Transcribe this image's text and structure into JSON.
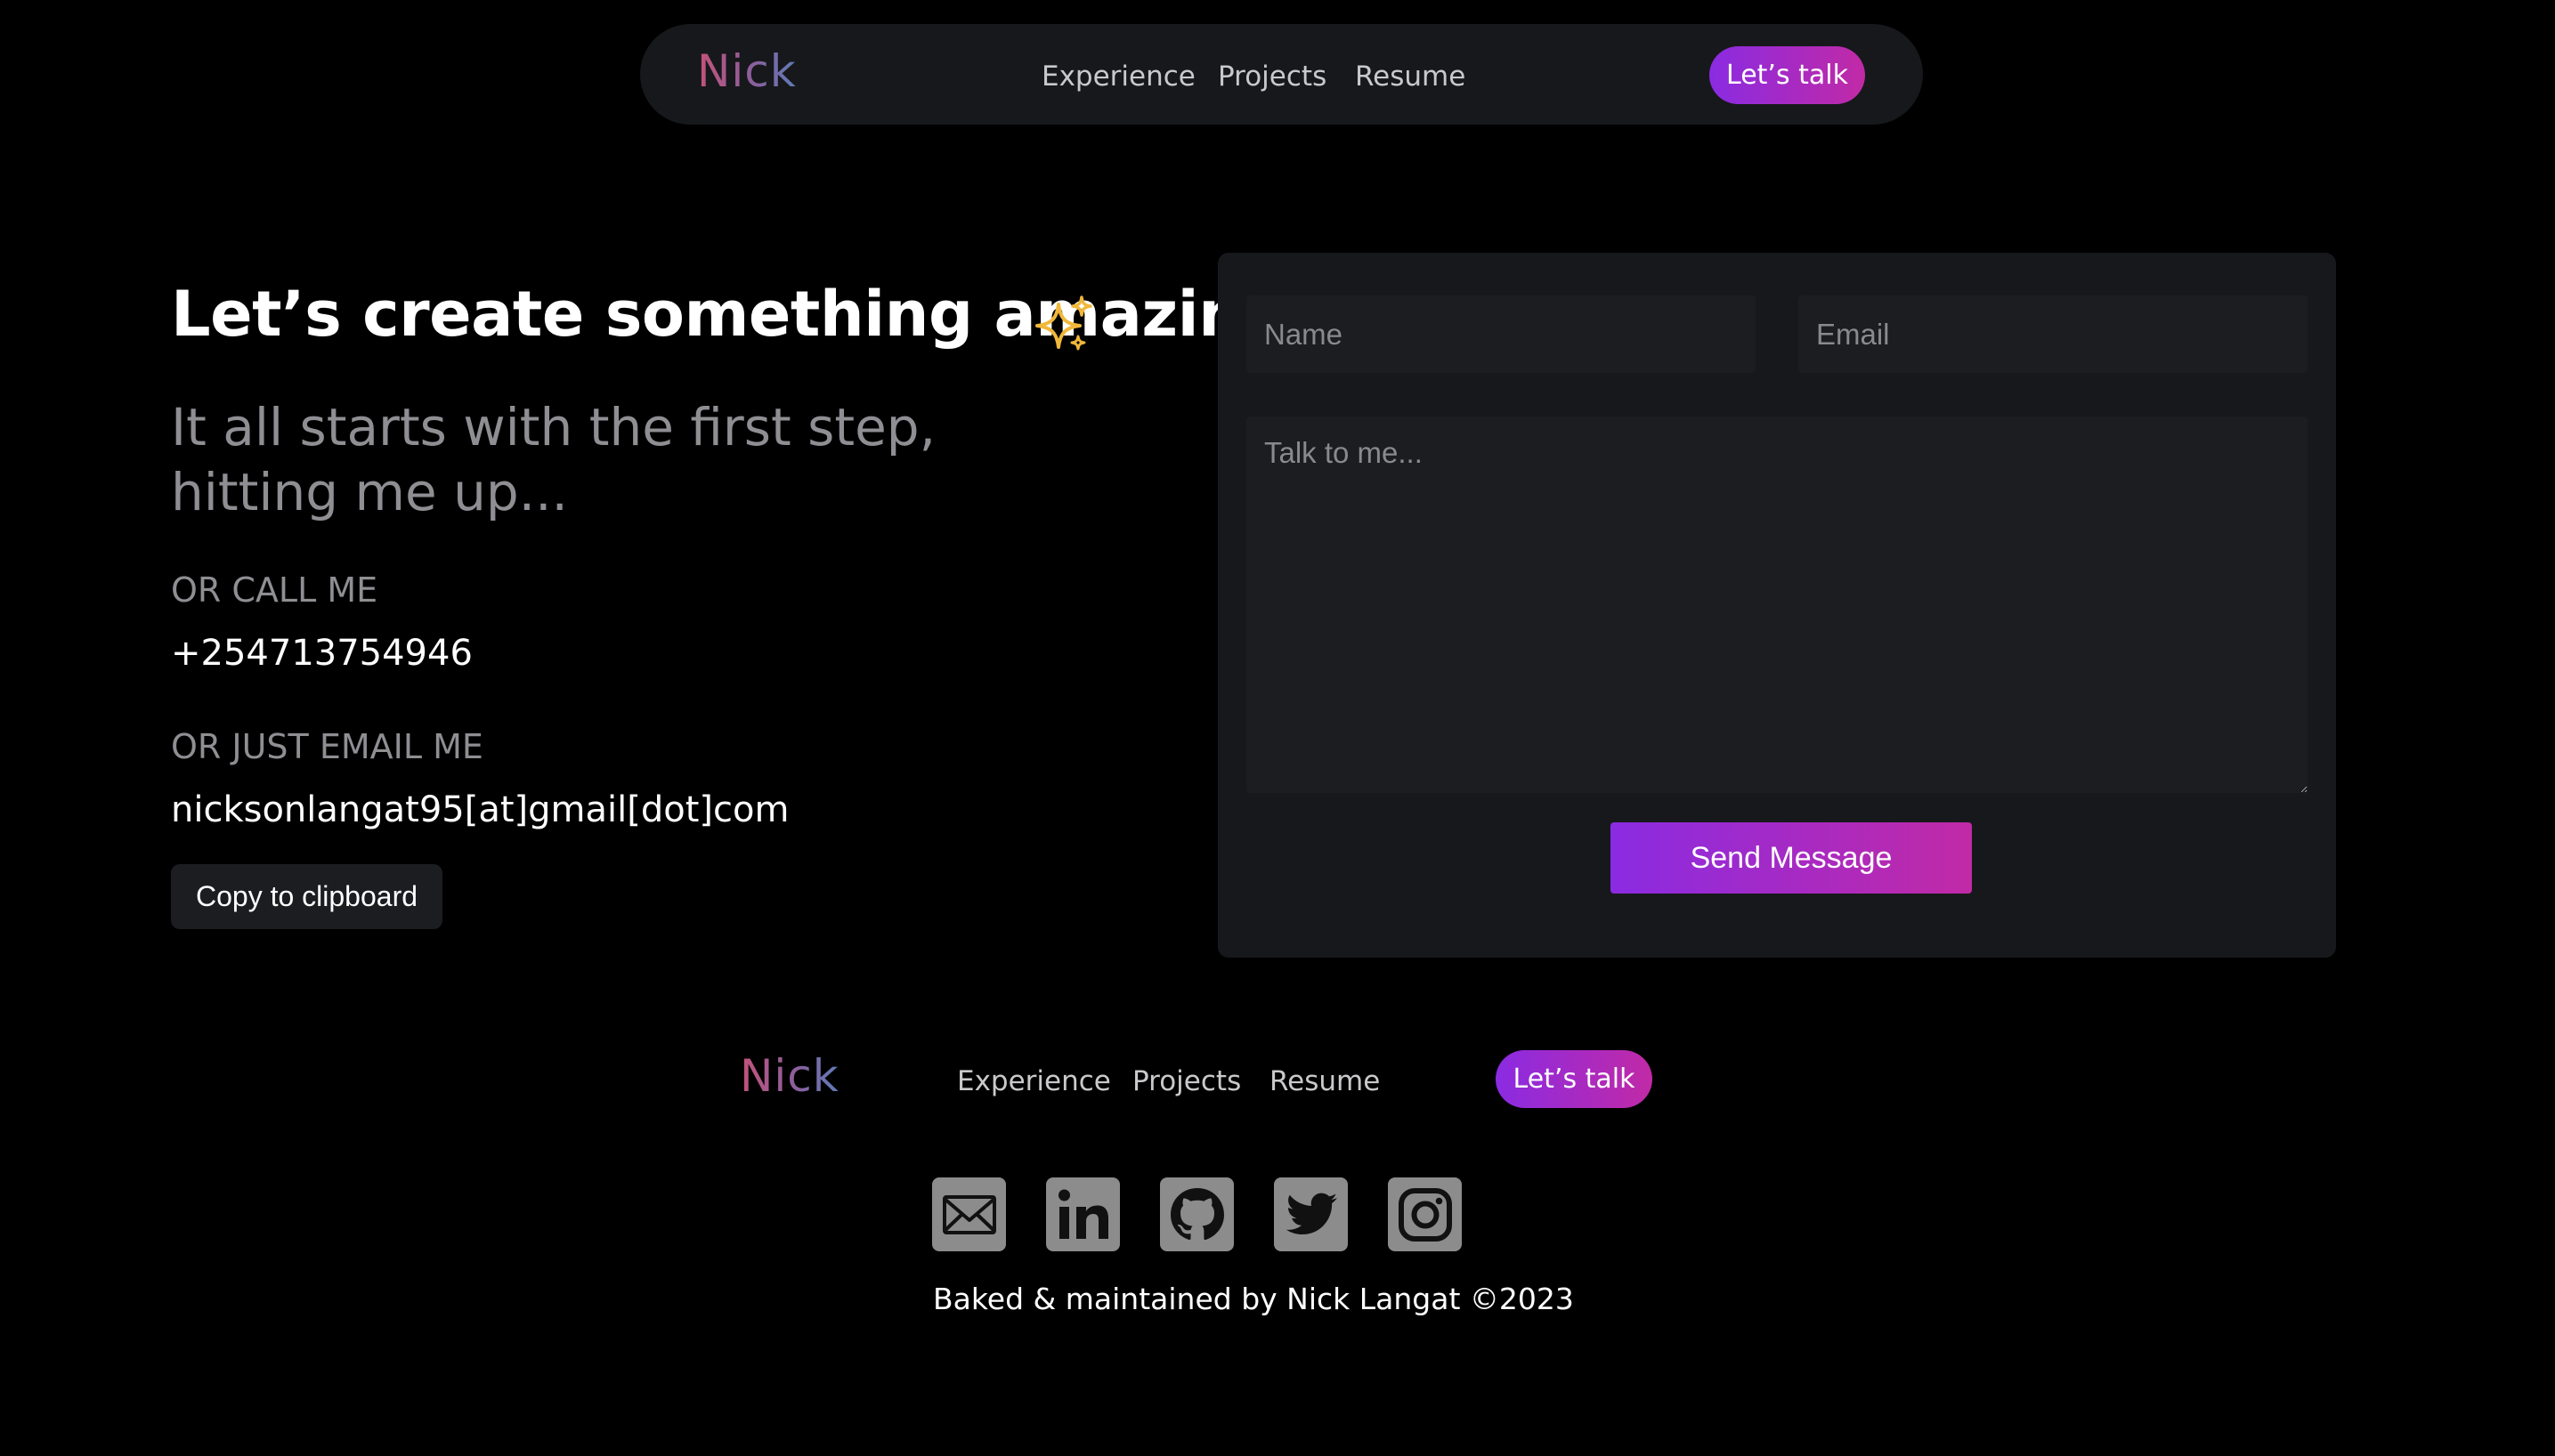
{
  "nav": {
    "logo": "Nick",
    "links": [
      "Experience",
      "Projects",
      "Resume"
    ],
    "cta": "Let’s talk"
  },
  "hero": {
    "headline": "Let’s create something amazing",
    "subline_1": "It all starts with the first step,",
    "subline_2": "hitting me up...",
    "call_label": "OR CALL ME",
    "phone": "+254713754946",
    "email_label": "OR JUST EMAIL ME",
    "email": "nicksonlangat95[at]gmail[dot]com",
    "copy_button": "Copy to clipboard"
  },
  "form": {
    "name_placeholder": "Name",
    "email_placeholder": "Email",
    "message_placeholder": "Talk to me...",
    "send_button": "Send Message"
  },
  "footer": {
    "logo": "Nick",
    "links": [
      "Experience",
      "Projects",
      "Resume"
    ],
    "cta": "Let’s talk",
    "social_icons": [
      "mail-icon",
      "linkedin-icon",
      "github-icon",
      "twitter-icon",
      "instagram-icon"
    ],
    "credit": "Baked & maintained by Nick Langat ©2023"
  },
  "colors": {
    "background": "#000000",
    "surface": "#17181b",
    "accent_start": "#8a2be2",
    "accent_end": "#c12aa6",
    "sparkle": "#f0b73a",
    "muted_text": "#8e8e93",
    "icon_gray": "#8c8c8c"
  }
}
